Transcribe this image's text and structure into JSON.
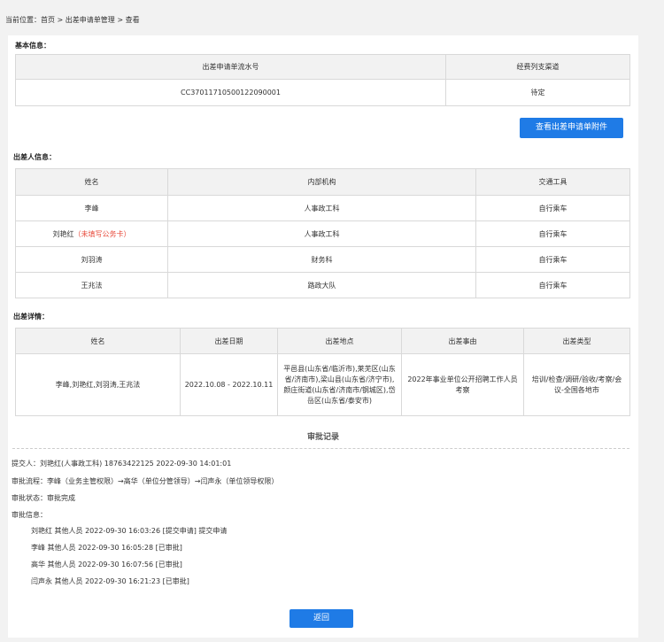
{
  "breadcrumb": "当前位置：首页 > 出差申请单管理 > 查看",
  "basic": {
    "title": "基本信息：",
    "headers": [
      "出差申请单流水号",
      "经费列支渠道"
    ],
    "row": [
      "CC370117105001220​90001",
      "待定"
    ]
  },
  "attachment_button": "查看出差申请单附件",
  "travelers": {
    "title": "出差人信息：",
    "headers": [
      "姓名",
      "内部机构",
      "交通工具"
    ],
    "rows": [
      {
        "name": "李峰",
        "note": "",
        "dept": "人事政工科",
        "transport": "自行乘车"
      },
      {
        "name": "刘艳红",
        "note": "（未填写公务卡）",
        "dept": "人事政工科",
        "transport": "自行乘车"
      },
      {
        "name": "刘羽涛",
        "note": "",
        "dept": "财务科",
        "transport": "自行乘车"
      },
      {
        "name": "王兆法",
        "note": "",
        "dept": "路政大队",
        "transport": "自行乘车"
      }
    ]
  },
  "details": {
    "title": "出差详情：",
    "headers": [
      "姓名",
      "出差日期",
      "出差地点",
      "出差事由",
      "出差类型"
    ],
    "row": {
      "names": "李峰,刘艳红,刘羽涛,王兆法",
      "dates": "2022.10.08 - 2022.10.11",
      "places": "平邑县(山东省/临沂市),莱芜区(山东省/济南市),梁山县(山东省/济宁市),颜庄街道(山东省/济南市/钢城区),岱岳区(山东省/泰安市)",
      "reason": "2022年事业单位公开招聘工作人员考察",
      "type": "培训/检查/调研/验收/考察/会议-全国各地市"
    }
  },
  "approval": {
    "title": "审批记录",
    "submitter": "提交人：刘艳红(人事政工科) 18763422125 2022-09-30 14:01:01",
    "flow": "审批流程：李峰（业务主管权限）→高华（单位分管领导）→闫声永（单位领导权限）",
    "status": "审批状态：审批完成",
    "info_label": "审批信息：",
    "entries": [
      "刘艳红 其他人员 2022-09-30 16:03:26 [提交申请] 提交申请",
      "李峰 其他人员 2022-09-30 16:05:28 [已审批]",
      "高华 其他人员 2022-09-30 16:07:56 [已审批]",
      "闫声永 其他人员 2022-09-30 16:21:23 [已审批]"
    ]
  },
  "back_button": "返回"
}
